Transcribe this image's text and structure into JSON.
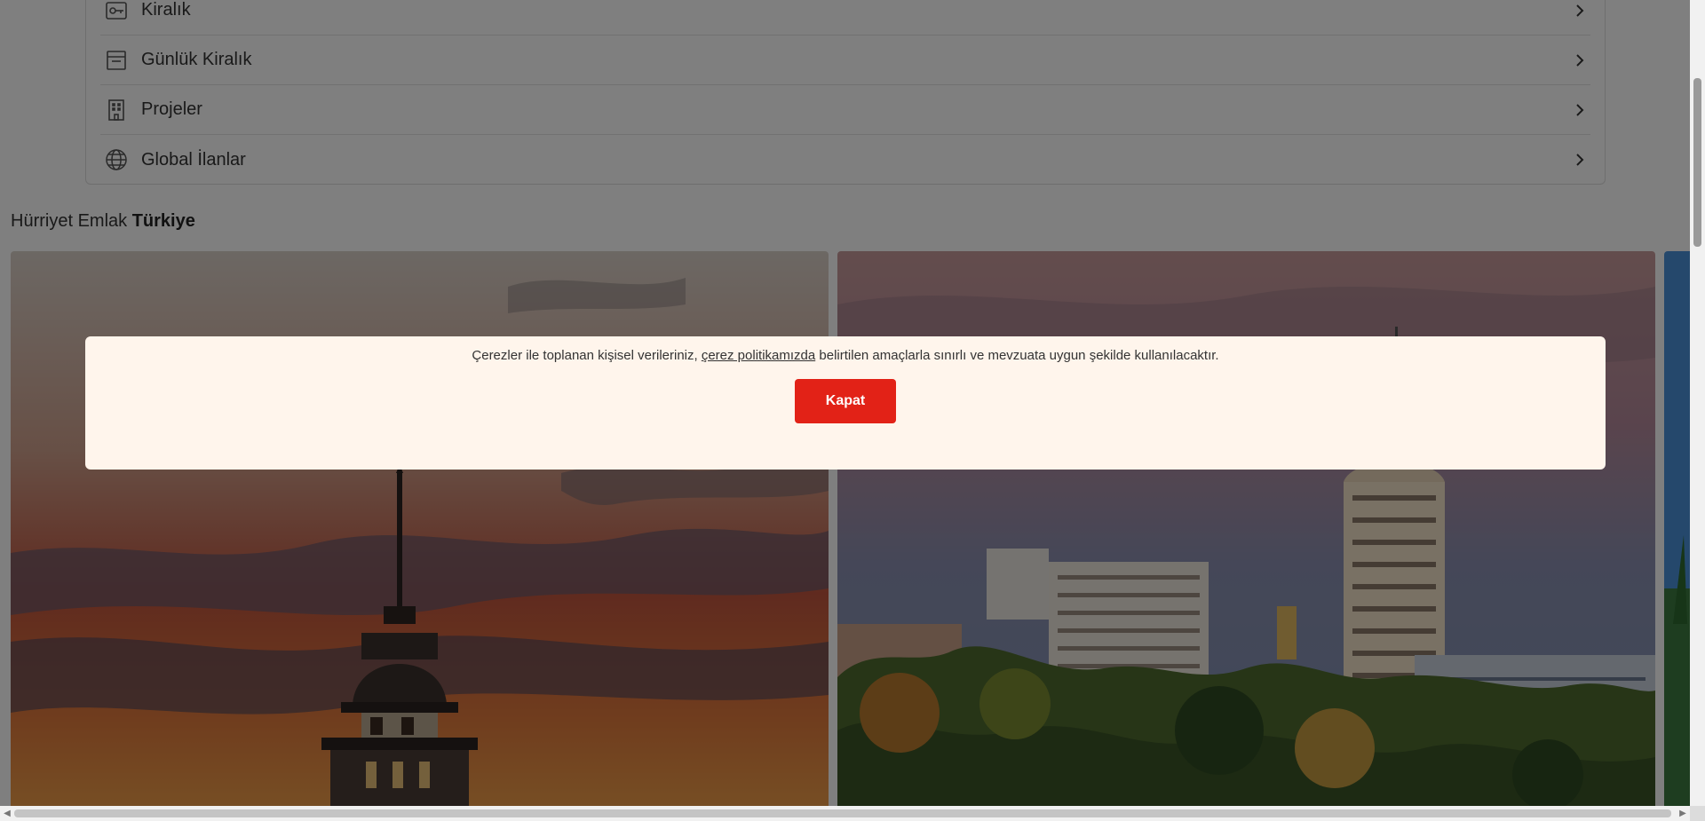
{
  "menu": {
    "items": [
      {
        "label": "Kiralık",
        "icon": "rent-tag-icon"
      },
      {
        "label": "Günlük Kiralık",
        "icon": "calendar-icon"
      },
      {
        "label": "Projeler",
        "icon": "building-icon"
      },
      {
        "label": "Global İlanlar",
        "icon": "globe-icon"
      }
    ]
  },
  "section": {
    "title_prefix": "Hürriyet Emlak",
    "title_bold": "Türkiye"
  },
  "cards": [
    {
      "image": "istanbul-maidens-tower-photo"
    },
    {
      "image": "ankara-cityscape-photo"
    },
    {
      "image": "partial-city-photo"
    }
  ],
  "cookie_banner": {
    "text_before": "Çerezler ile toplanan kişisel verileriniz, ",
    "link_text": "çerez politikamızda",
    "text_after": " belirtilen amaçlarla sınırlı ve mevzuata uygun şekilde kullanılacaktır.",
    "close_label": "Kapat",
    "accent_color": "#e22217",
    "background_color": "#fff5ec"
  },
  "scrollbar": {
    "left_arrow": "◀",
    "right_arrow": "▶"
  }
}
